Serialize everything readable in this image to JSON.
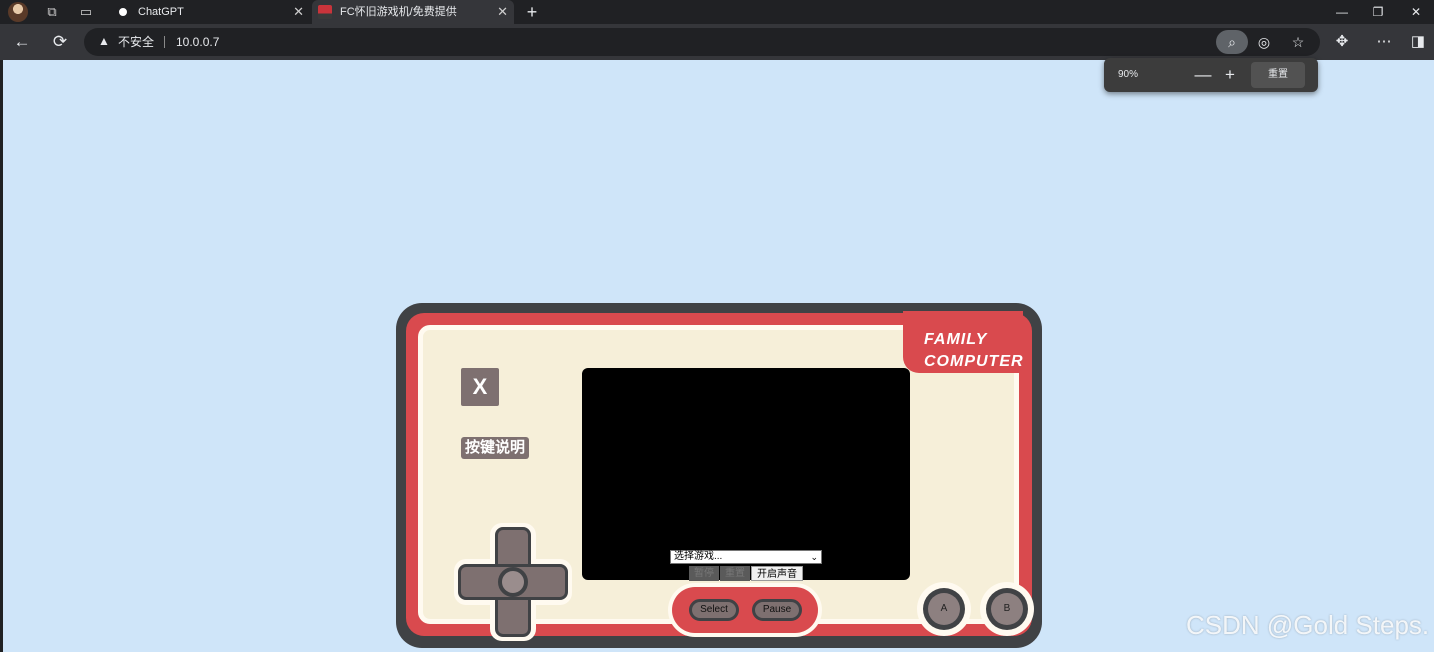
{
  "tabs": [
    {
      "title": "ChatGPT",
      "close": "✕"
    },
    {
      "title": "FC怀旧游戏机/免费提供",
      "close": "✕"
    }
  ],
  "new_tab": "+",
  "window_controls": {
    "minimize": "—",
    "restore": "❐",
    "close": "✕"
  },
  "toolbar": {
    "back": "←",
    "reload": "⟳",
    "security_text": "不安全",
    "url": "10.0.0.7"
  },
  "zoom_popup": {
    "level": "90%",
    "minus": "—",
    "plus": "+",
    "reset_label": "重置"
  },
  "console": {
    "brand_line1": "FAMILY",
    "brand_line2": "COMPUTER",
    "x_button": "X",
    "key_help": "按键说明",
    "game_select_placeholder": "选择游戏...",
    "control_buttons": [
      "暂停",
      "重置"
    ],
    "sound_button": "开启声音",
    "select_label": "Select",
    "pause_label": "Pause",
    "a_label": "A",
    "b_label": "B"
  },
  "watermark": "CSDN @Gold Steps.",
  "colors": {
    "page_background": "#cfe5f9",
    "console_frame": "#404245",
    "console_red": "#d94a4e",
    "console_cream": "#f6efd9",
    "button_gray": "#7e7070"
  }
}
